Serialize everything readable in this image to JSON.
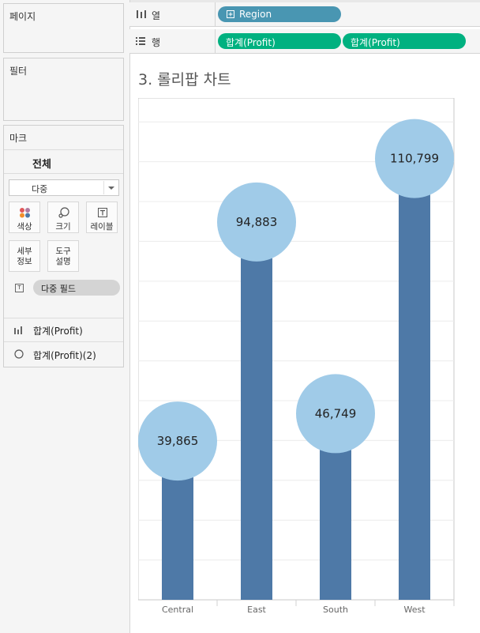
{
  "left": {
    "pages_label": "페이지",
    "filters_label": "필터",
    "marks": {
      "title": "마크",
      "all_label": "전체",
      "mark_type": "다중",
      "buttons": {
        "color": "색상",
        "size": "크기",
        "label": "레이블",
        "detail": [
          "세부",
          "정보"
        ],
        "tooltip": [
          "도구",
          "설명"
        ]
      },
      "field_pill": "다중 필드",
      "measures": [
        {
          "name": "합계",
          "suffix": "(Profit)",
          "icon": "bar-chart-icon"
        },
        {
          "name": "합계",
          "suffix": "(Profit)(2)",
          "icon": "circle-icon"
        }
      ]
    }
  },
  "shelves": {
    "columns": {
      "label": "열",
      "pill": "Region",
      "icon": "columns-icon"
    },
    "rows": {
      "label": "행",
      "pills": [
        "합계(Profit)",
        "합계(Profit)"
      ],
      "icon": "rows-icon"
    }
  },
  "sheet_title": "3. 롤리팝 차트",
  "colors": {
    "bar": "#4e79a7",
    "circle": "#a0cbe8",
    "dimension_pill": "#4996b2",
    "measure_pill": "#00b180"
  },
  "chart_data": {
    "type": "bar",
    "subtype": "lollipop",
    "categories": [
      "Central",
      "East",
      "South",
      "West"
    ],
    "values": [
      39865,
      94883,
      46749,
      110799
    ],
    "labels": [
      "39,865",
      "94,883",
      "46,749",
      "110,799"
    ],
    "ylim": [
      0,
      126000
    ],
    "grid": true,
    "y_axis_visible": false
  }
}
